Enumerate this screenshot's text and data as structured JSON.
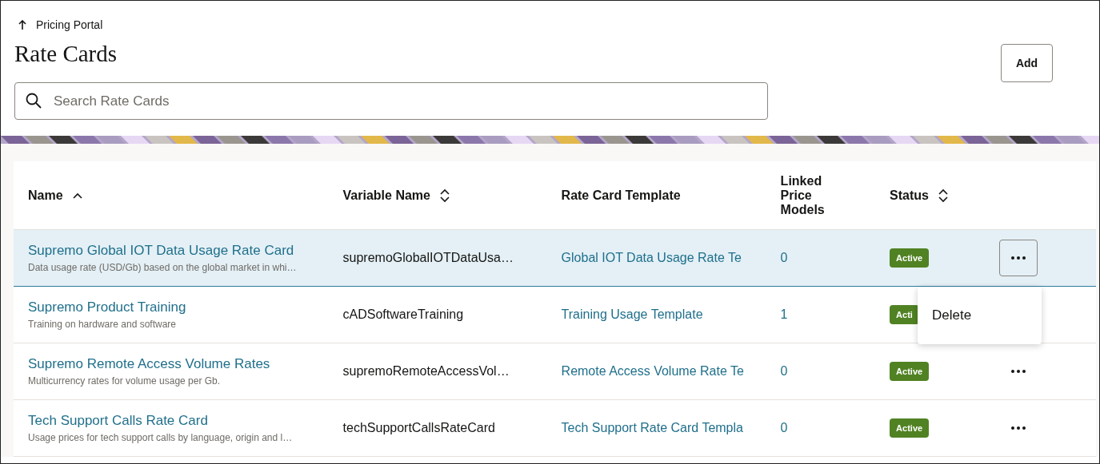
{
  "breadcrumb": {
    "label": "Pricing Portal"
  },
  "title": "Rate Cards",
  "add_button": "Add",
  "search": {
    "placeholder": "Search Rate Cards"
  },
  "table": {
    "columns": [
      {
        "label": "Name",
        "kind": "ascending"
      },
      {
        "label": "Variable Name",
        "kind": "sortable"
      },
      {
        "label": "Rate Card Template",
        "kind": "plain"
      },
      {
        "label": "Linked Price Models",
        "kind": "plain"
      },
      {
        "label": "Status",
        "kind": "sortable"
      }
    ],
    "rows": [
      {
        "name": "Supremo Global IOT Data Usage Rate Card",
        "description": "Data usage rate (USD/Gb) based on the global market in whi…",
        "variable_name": "supremoGlobalIOTDataUsa…",
        "template": "Global IOT Data Usage Rate Te",
        "linked_price_models": "0",
        "status": "Active",
        "selected": true,
        "kind": "focused"
      },
      {
        "name": "Supremo Product Training",
        "description": "Training on hardware and software",
        "variable_name": "cADSoftwareTraining",
        "template": "Training Usage Template",
        "linked_price_models": "1",
        "status": "Acti",
        "selected": false,
        "kind": "covered"
      },
      {
        "name": "Supremo Remote Access Volume Rates",
        "description": "Multicurrency rates for volume usage per Gb.",
        "variable_name": "supremoRemoteAccessVol…",
        "template": "Remote Access Volume Rate Te",
        "linked_price_models": "0",
        "status": "Active",
        "selected": false,
        "kind": "plain"
      },
      {
        "name": "Tech Support Calls Rate Card",
        "description": "Usage prices for tech support calls by language, origin and l…",
        "variable_name": "techSupportCallsRateCard",
        "template": "Tech Support Rate Card Templa",
        "linked_price_models": "0",
        "status": "Active",
        "selected": false,
        "kind": "plain"
      }
    ]
  },
  "row_menu": {
    "items": [
      "Delete"
    ]
  }
}
